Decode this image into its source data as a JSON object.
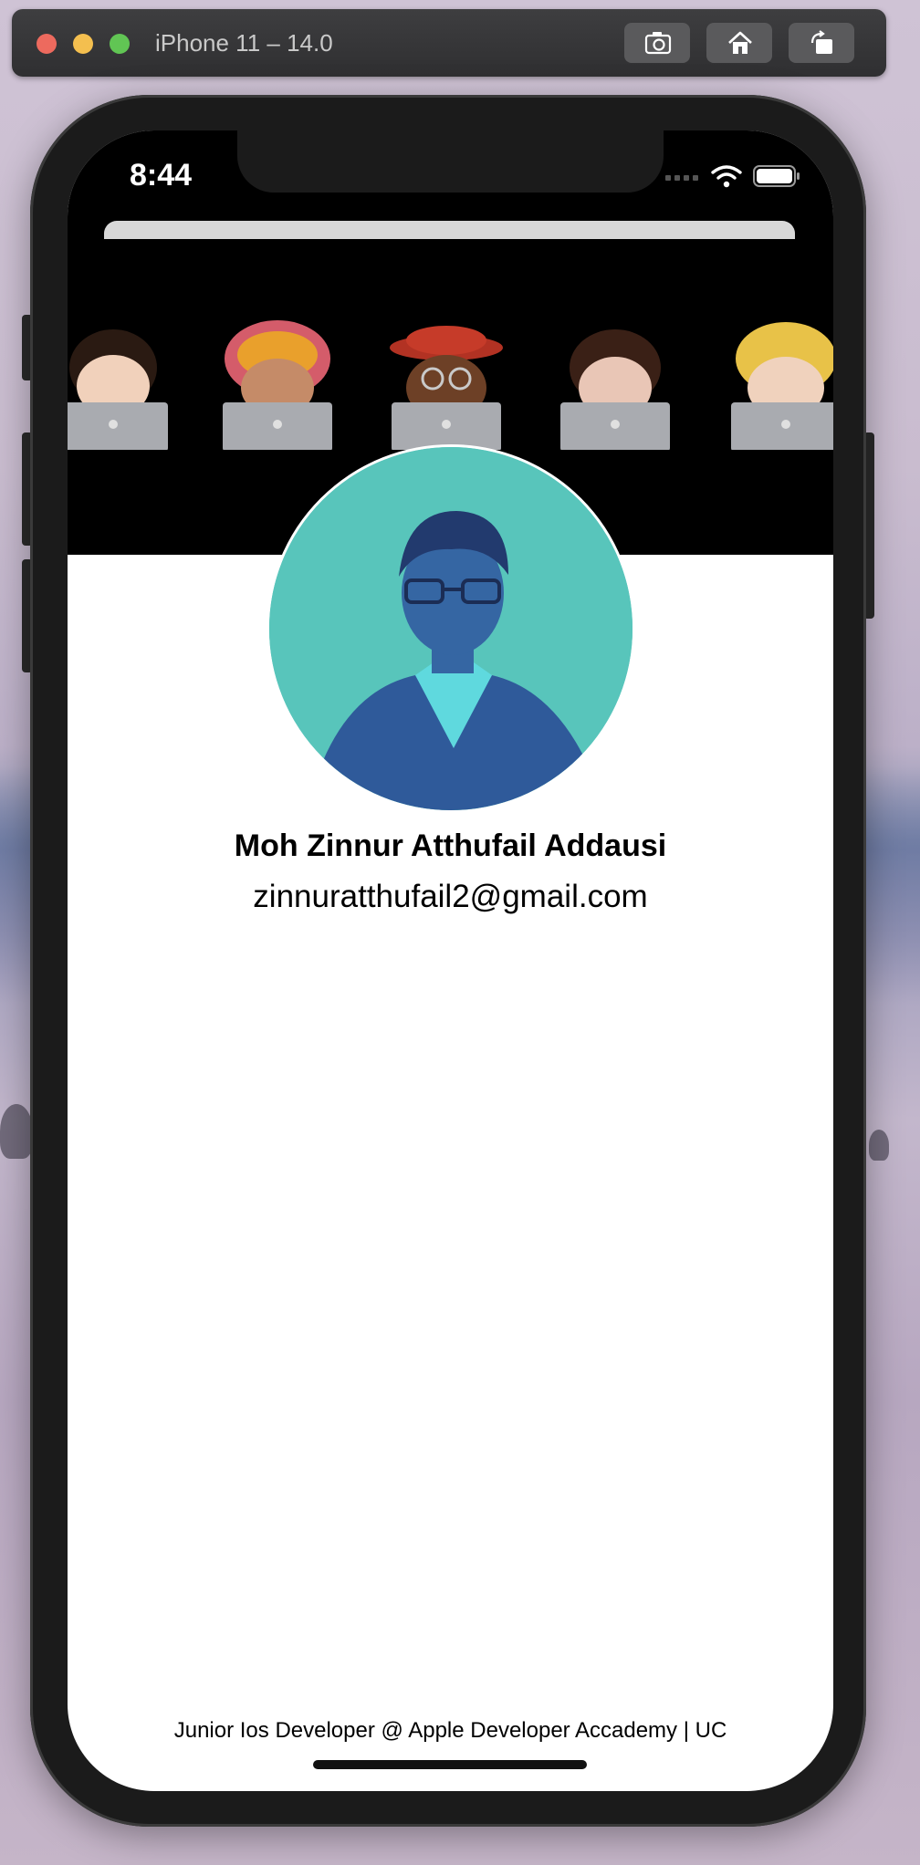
{
  "window": {
    "title": "iPhone 11 – 14.0",
    "buttons": [
      {
        "name": "screenshot",
        "icon": "camera-icon"
      },
      {
        "name": "home",
        "icon": "home-icon"
      },
      {
        "name": "rotate",
        "icon": "rotate-icon"
      }
    ]
  },
  "status_bar": {
    "time": "8:44",
    "icons": [
      "signal-icon",
      "wifi-icon",
      "battery-icon"
    ]
  },
  "profile": {
    "name": "Moh Zinnur Atthufail Addausi",
    "email": "zinnuratthufail2@gmail.com",
    "footer": "Junior Ios Developer @ Apple Developer Accademy | UC"
  },
  "colors": {
    "header_bg": "#000000",
    "avatar_bg": "#58c5bb",
    "avatar_figure": "#2f5a9a",
    "content_bg": "#ffffff"
  }
}
